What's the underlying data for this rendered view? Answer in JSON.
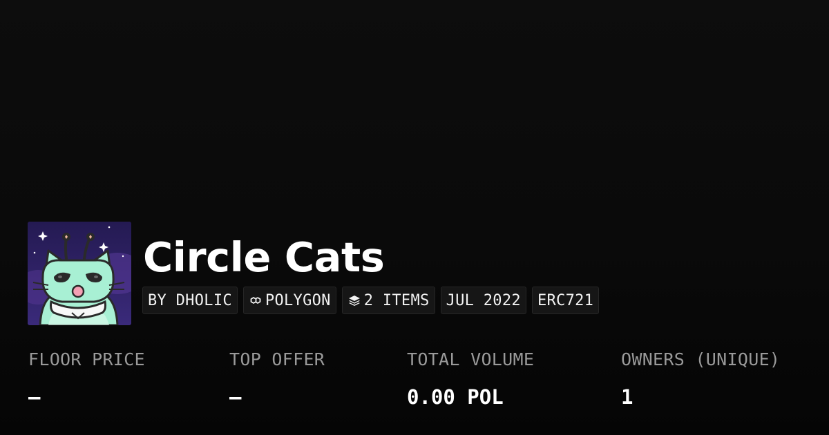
{
  "collection": {
    "name": "Circle Cats"
  },
  "chips": {
    "creator": "BY DHOLIC",
    "chain": "POLYGON",
    "items": "2 ITEMS",
    "date": "JUL 2022",
    "standard": "ERC721",
    "chain_icon": "polygon-icon",
    "items_icon": "layers-icon"
  },
  "stats": {
    "floor_price": {
      "label": "FLOOR PRICE",
      "value": "–"
    },
    "top_offer": {
      "label": "TOP OFFER",
      "value": "–"
    },
    "total_volume": {
      "label": "TOTAL VOLUME",
      "value": "0.00 POL"
    },
    "owners": {
      "label": "OWNERS (UNIQUE)",
      "value": "1"
    }
  },
  "colors": {
    "background": "#0b0b0b",
    "chip_bg": "#161616",
    "label_gray": "#9a9a9a",
    "avatar_cat": "#a8f0d4"
  }
}
